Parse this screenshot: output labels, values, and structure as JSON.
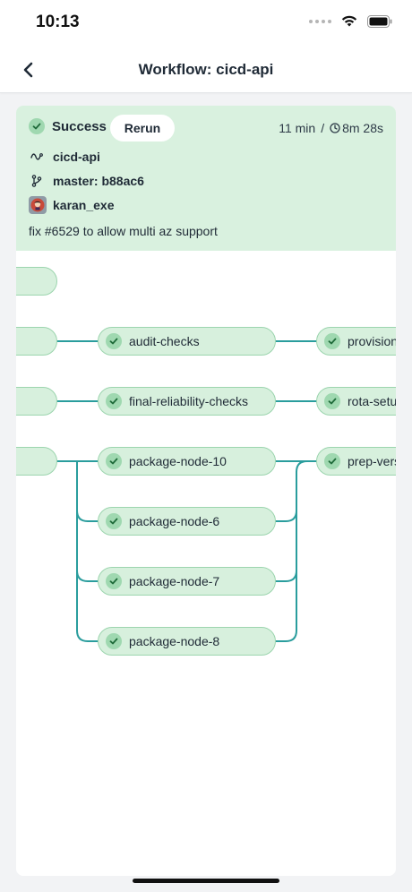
{
  "status_bar": {
    "time": "10:13"
  },
  "nav": {
    "title": "Workflow: cicd-api",
    "back_icon": "chevron-left-icon"
  },
  "summary": {
    "status": "Success",
    "rerun_label": "Rerun",
    "elapsed": "11 min",
    "separator": "/",
    "duration": "8m 28s",
    "project": "cicd-api",
    "branch": "master: b88ac6",
    "user": "karan_exe",
    "commit_message": "fix #6529 to allow multi az support",
    "colors": {
      "summary_bg": "#d9f1df",
      "node_bg": "#d7f0dd",
      "node_border": "#9cd5ae",
      "check_bg": "#9fd8b0",
      "line": "#2a9d9d"
    }
  },
  "graph": {
    "middle_nodes": [
      "audit-checks",
      "final-reliability-checks",
      "package-node-10",
      "package-node-6",
      "package-node-7",
      "package-node-8"
    ],
    "right_nodes": [
      "provision",
      "rota-setup",
      "prep-version"
    ]
  }
}
